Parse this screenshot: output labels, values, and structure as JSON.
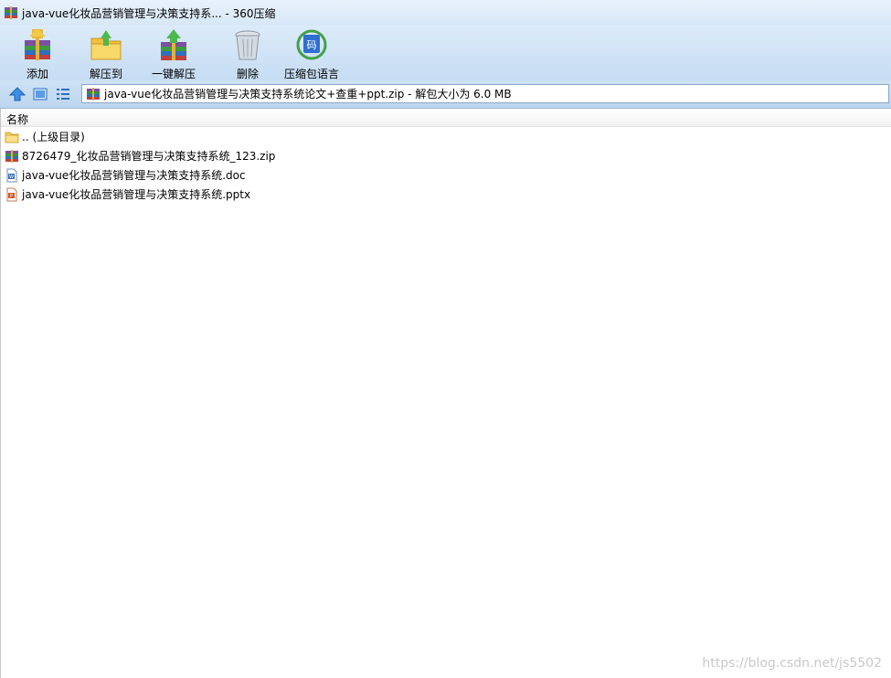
{
  "window": {
    "title": "java-vue化妆品营销管理与决策支持系... - 360压缩",
    "accent": "#d7e7f7"
  },
  "toolbar": {
    "items": [
      {
        "label": "添加",
        "icon": "add-archive-icon"
      },
      {
        "label": "解压到",
        "icon": "extract-to-icon"
      },
      {
        "label": "一键解压",
        "icon": "one-click-extract-icon"
      },
      {
        "label": "删除",
        "icon": "trash-icon"
      },
      {
        "label": "压缩包语言",
        "icon": "archive-language-icon"
      }
    ]
  },
  "navbar": {
    "path": "java-vue化妆品营销管理与决策支持系统论文+查重+ppt.zip - 解包大小为 6.0 MB"
  },
  "filelist": {
    "column_name": "名称",
    "rows": [
      {
        "name": ".. (上级目录)",
        "icon": "folder-icon"
      },
      {
        "name": "8726479_化妆品营销管理与决策支持系统_123.zip",
        "icon": "zip-archive-icon"
      },
      {
        "name": "java-vue化妆品营销管理与决策支持系统.doc",
        "icon": "word-doc-icon"
      },
      {
        "name": "java-vue化妆品营销管理与决策支持系统.pptx",
        "icon": "powerpoint-icon"
      }
    ]
  },
  "watermark": "https://blog.csdn.net/js5502"
}
